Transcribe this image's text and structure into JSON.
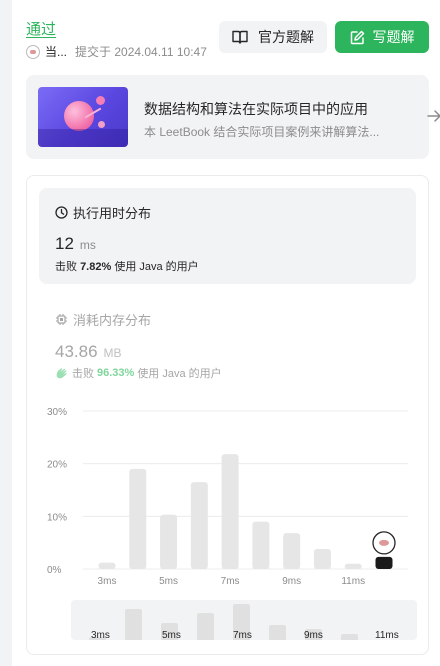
{
  "submission": {
    "status": "通过",
    "user": "当...",
    "submitted_at": "提交于 2024.04.11 10:47"
  },
  "buttons": {
    "official": "官方题解",
    "write": "写题解"
  },
  "book": {
    "title": "数据结构和算法在实际项目中的应用",
    "desc": "本 LeetBook 结合实际项目案例来讲解算法..."
  },
  "runtime": {
    "title": "执行用时分布",
    "value": "12",
    "unit": "ms",
    "beat_prefix": "击败",
    "beat_pct": "7.82%",
    "beat_suffix": "使用 Java 的用户"
  },
  "memory": {
    "title": "消耗内存分布",
    "value": "43.86",
    "unit": "MB",
    "beat_prefix": "击败",
    "beat_pct": "96.33%",
    "beat_suffix": "使用 Java 的用户"
  },
  "colors": {
    "accent": "#2db55d",
    "bar": "#e6e6e6",
    "bar_highlight": "#1a1a1a"
  },
  "icons": {
    "official": "book-open-icon",
    "write": "edit-icon",
    "runtime": "clock-icon",
    "memory": "chip-icon",
    "book_link": "arrow-right-icon",
    "beat": "clap-icon"
  },
  "chart_data": {
    "type": "bar",
    "categories": [
      "3ms",
      "4ms",
      "5ms",
      "6ms",
      "7ms",
      "8ms",
      "9ms",
      "10ms",
      "11ms",
      "12ms"
    ],
    "values": [
      1.2,
      19.0,
      10.3,
      16.5,
      21.8,
      9.0,
      6.8,
      3.8,
      1.0,
      2.3
    ],
    "highlight_index": 9,
    "x_tick_labels": [
      "3ms",
      "5ms",
      "7ms",
      "9ms",
      "11ms"
    ],
    "y_ticks": [
      "30%",
      "20%",
      "10%",
      "0%"
    ],
    "ylim": [
      0,
      30
    ],
    "grid": true
  },
  "mini_chart": {
    "values": [
      0.3,
      19.0,
      10.3,
      16.5,
      21.8,
      9.0,
      6.8,
      3.8
    ],
    "tick_labels": [
      "3ms",
      "5ms",
      "7ms",
      "9ms",
      "11ms"
    ]
  }
}
